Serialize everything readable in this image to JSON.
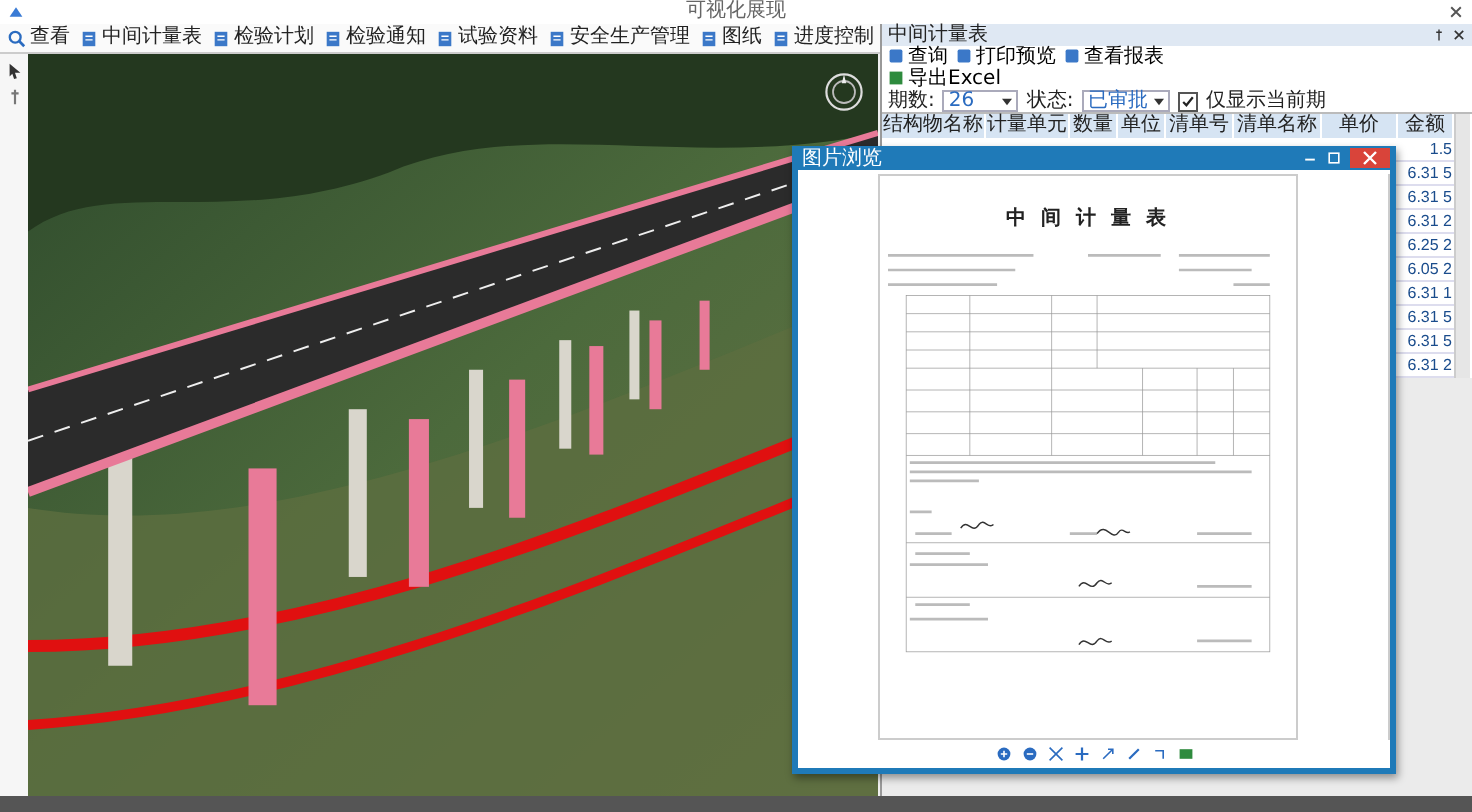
{
  "window": {
    "title": "可视化展现"
  },
  "toolbar": [
    {
      "label": "查看"
    },
    {
      "label": "中间计量表"
    },
    {
      "label": "检验计划"
    },
    {
      "label": "检验通知"
    },
    {
      "label": "试验资料"
    },
    {
      "label": "安全生产管理"
    },
    {
      "label": "图纸"
    },
    {
      "label": "进度控制"
    }
  ],
  "panel": {
    "title": "中间计量表",
    "actions": [
      "查询",
      "打印预览",
      "查看报表"
    ],
    "export": "导出Excel",
    "period_label": "期数:",
    "period_value": "26",
    "status_label": "状态:",
    "status_value": "已审批",
    "filter": {
      "label": "仅显示当前期",
      "checked": true
    },
    "columns": [
      "结构物名称",
      "计量单元",
      "数量",
      "单位",
      "清单号",
      "清单名称",
      "单价",
      "金额"
    ],
    "rows": [
      {
        "amount": "1.5"
      },
      {
        "amount": "6.31 5"
      },
      {
        "amount": "6.31 5"
      },
      {
        "amount": "6.31 2"
      },
      {
        "amount": "6.25 2"
      },
      {
        "amount": "6.05 2"
      },
      {
        "amount": "6.31 1"
      },
      {
        "amount": "6.31 5"
      },
      {
        "amount": "6.31 5"
      },
      {
        "amount": "6.31 2"
      }
    ]
  },
  "viewer": {
    "title": "图片浏览",
    "document_title": "中 间 计 量 表"
  }
}
